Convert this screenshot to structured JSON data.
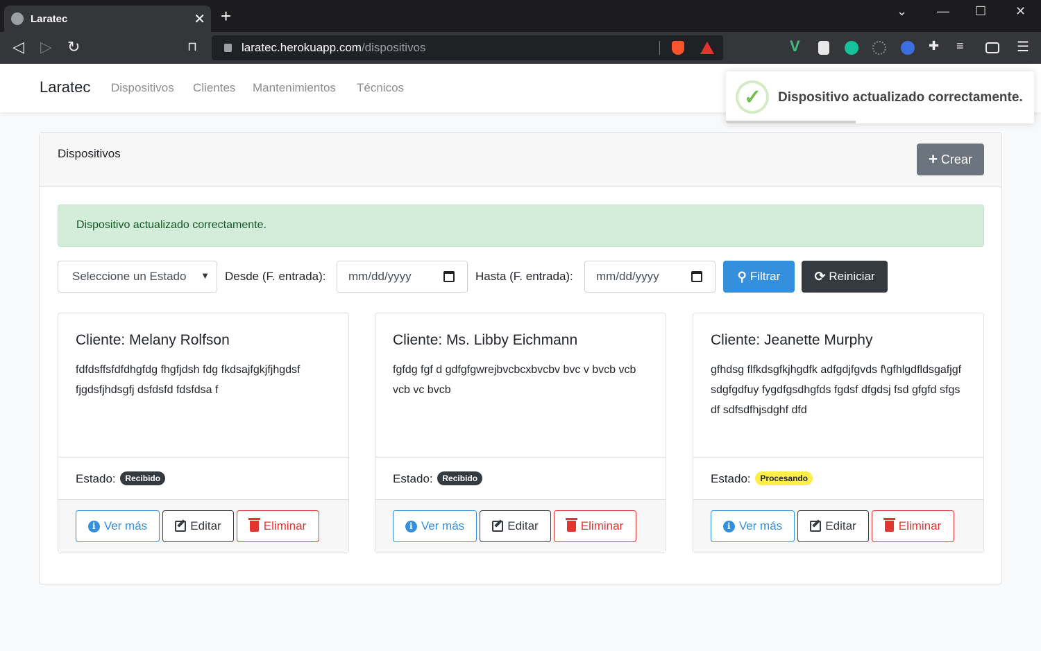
{
  "browser": {
    "tab_title": "Laratec",
    "url_host": "laratec.herokuapp.com",
    "url_path": "/dispositivos"
  },
  "nav": {
    "brand": "Laratec",
    "links": [
      "Dispositivos",
      "Clientes",
      "Mantenimientos",
      "Técnicos"
    ]
  },
  "toast": {
    "message": "Dispositivo actualizado correctamente.",
    "icon": "check-circle-icon"
  },
  "card": {
    "title": "Dispositivos",
    "create_button": "Crear",
    "alert": "Dispositivo actualizado correctamente."
  },
  "filters": {
    "estado_select": "Seleccione un Estado",
    "desde_label": "Desde (F. entrada):",
    "desde_value": "mm/dd/yyyy",
    "hasta_label": "Hasta (F. entrada):",
    "hasta_value": "mm/dd/yyyy",
    "filter_button": "Filtrar",
    "reset_button": "Reiniciar"
  },
  "labels": {
    "estado": "Estado:",
    "ver_mas": "Ver más",
    "editar": "Editar",
    "eliminar": "Eliminar"
  },
  "devices": [
    {
      "cliente": "Cliente: Melany Rolfson",
      "descripcion": "fdfdsffsfdfdhgfdg fhgfjdsh fdg fkdsajfgkjfjhgdsf fjgdsfjhdsgfj dsfdsfd fdsfdsa f",
      "estado": "Recibido",
      "estado_color": "#343a40"
    },
    {
      "cliente": "Cliente: Ms. Libby Eichmann",
      "descripcion": "fgfdg fgf d gdfgfgwrejbvcbcxbvcbv bvc v bvcb vcb vcb vc bvcb",
      "estado": "Recibido",
      "estado_color": "#343a40"
    },
    {
      "cliente": "Cliente: Jeanette Murphy",
      "descripcion": "gfhdsg flfkdsgfkjhgdfk adfgdjfgvds f\\gfhlgdfldsgafjgf sdgfgdfuy fygdfgsdhgfds fgdsf dfgdsj fsd gfgfd sfgs df sdfsdfhjsdghf dfd",
      "estado": "Procesando",
      "estado_color": "#ffed4a"
    }
  ]
}
